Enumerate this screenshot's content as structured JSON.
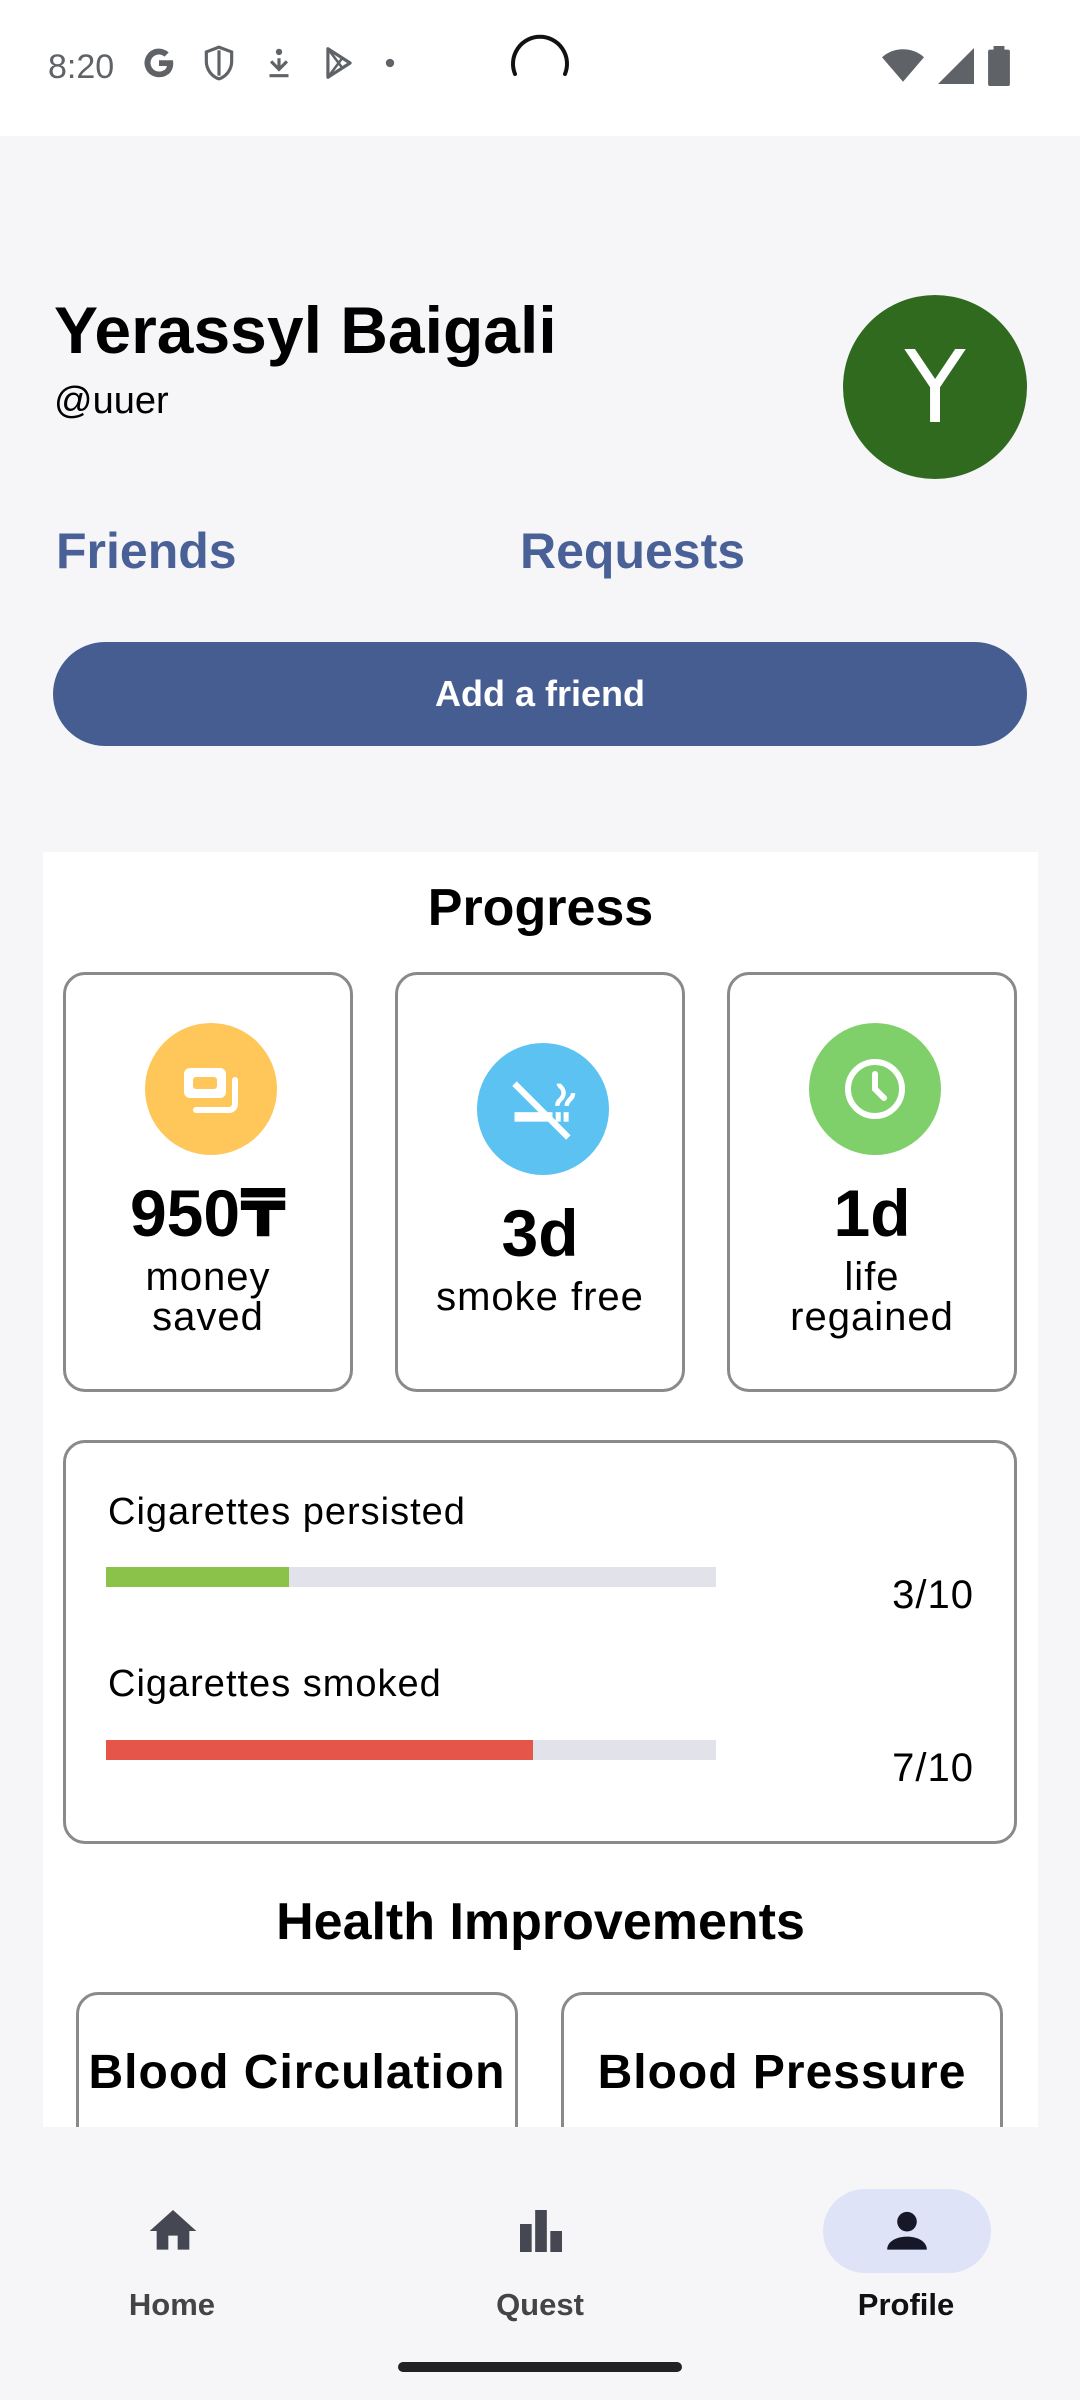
{
  "status_bar": {
    "time": "8:20"
  },
  "header": {
    "name": "Yerassyl Baigali",
    "handle": "@uuer",
    "avatar_letter": "Y",
    "avatar_color": "#2f6a1f"
  },
  "links": {
    "friends": "Friends",
    "requests": "Requests"
  },
  "add_friend_label": "Add a friend",
  "progress": {
    "title": "Progress",
    "stats": [
      {
        "value": "950₸",
        "label_line1": "money",
        "label_line2": "saved",
        "icon": "money-icon",
        "icon_color": "#ffc75a"
      },
      {
        "value": "3d",
        "label_line1": "smoke free",
        "label_line2": "",
        "icon": "no-smoking-icon",
        "icon_color": "#5bc2f2"
      },
      {
        "value": "1d",
        "label_line1": "life",
        "label_line2": "regained",
        "icon": "clock-icon",
        "icon_color": "#7fd06a"
      }
    ],
    "bars": [
      {
        "label": "Cigarettes persisted",
        "count": "3/10",
        "fraction": 0.3,
        "color": "#8bc34a"
      },
      {
        "label": "Cigarettes smoked",
        "count": "7/10",
        "fraction": 0.7,
        "color": "#e5554a"
      }
    ]
  },
  "health": {
    "title": "Health Improvements",
    "cards": [
      "Blood Circulation",
      "Blood Pressure"
    ]
  },
  "nav": {
    "items": [
      {
        "label": "Home",
        "icon": "home-icon",
        "active": false
      },
      {
        "label": "Quest",
        "icon": "bar-chart-icon",
        "active": false
      },
      {
        "label": "Profile",
        "icon": "person-icon",
        "active": true
      }
    ]
  }
}
